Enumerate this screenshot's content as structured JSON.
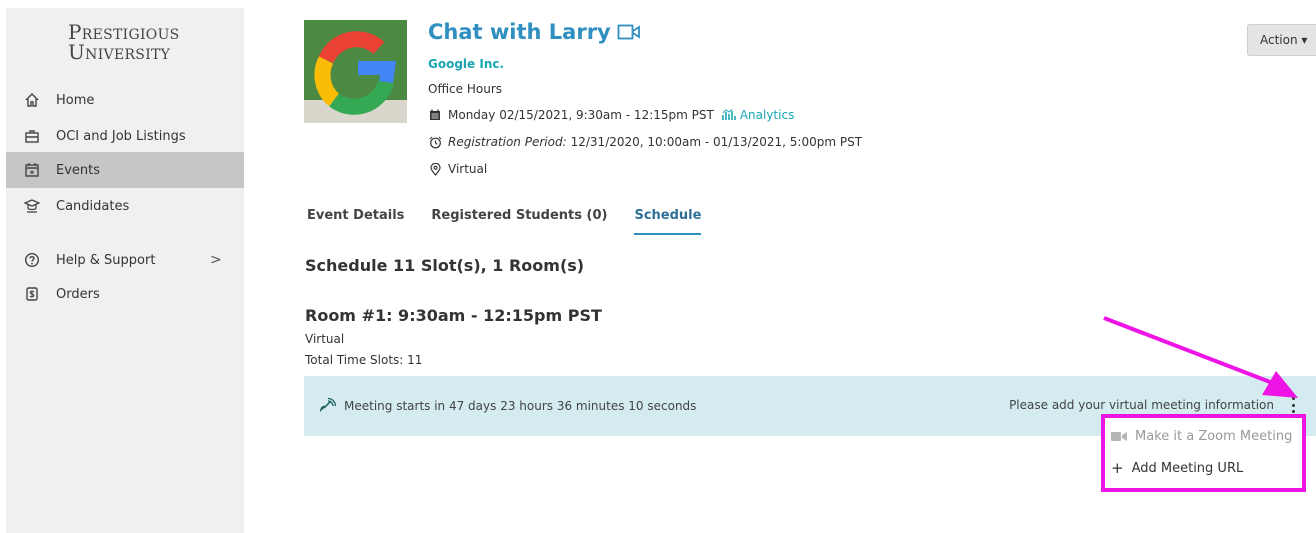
{
  "sidebar": {
    "logo_line1": "Prestigious",
    "logo_line2": "University",
    "items": [
      {
        "label": "Home",
        "icon": "home-icon"
      },
      {
        "label": "OCI and Job Listings",
        "icon": "briefcase-icon"
      },
      {
        "label": "Events",
        "icon": "calendar-icon"
      },
      {
        "label": "Candidates",
        "icon": "graduate-icon"
      },
      {
        "label": "Help & Support",
        "icon": "help-icon"
      },
      {
        "label": "Orders",
        "icon": "receipt-icon"
      }
    ],
    "help_chevron": ">"
  },
  "event": {
    "title": "Chat with Larry",
    "company": "Google Inc.",
    "type": "Office Hours",
    "datetime": "Monday 02/15/2021, 9:30am - 12:15pm PST",
    "analytics_label": "Analytics",
    "registration_label": "Registration Period:",
    "registration_value": "12/31/2020, 10:00am - 01/13/2021, 5:00pm PST",
    "location": "Virtual"
  },
  "action_button": "Action ▾",
  "tabs": [
    {
      "label": "Event Details",
      "active": false
    },
    {
      "label": "Registered Students (0)",
      "active": false
    },
    {
      "label": "Schedule",
      "active": true
    }
  ],
  "schedule": {
    "heading": "Schedule 11 Slot(s), 1 Room(s)",
    "room_heading": "Room #1: 9:30am - 12:15pm PST",
    "room_location": "Virtual",
    "total_slots": "Total Time Slots: 11"
  },
  "banner": {
    "countdown": "Meeting starts in 47 days 23 hours 36 minutes 10 seconds",
    "prompt": "Please add your virtual meeting information"
  },
  "menu": {
    "zoom_label": "Make it a Zoom Meeting",
    "add_url_label": "Add Meeting URL",
    "add_url_prefix": "+"
  },
  "colors": {
    "accent": "#2f8fc0",
    "teal": "#19a7b5",
    "banner_bg": "#d4ebef",
    "annotation": "#ee14e6"
  }
}
